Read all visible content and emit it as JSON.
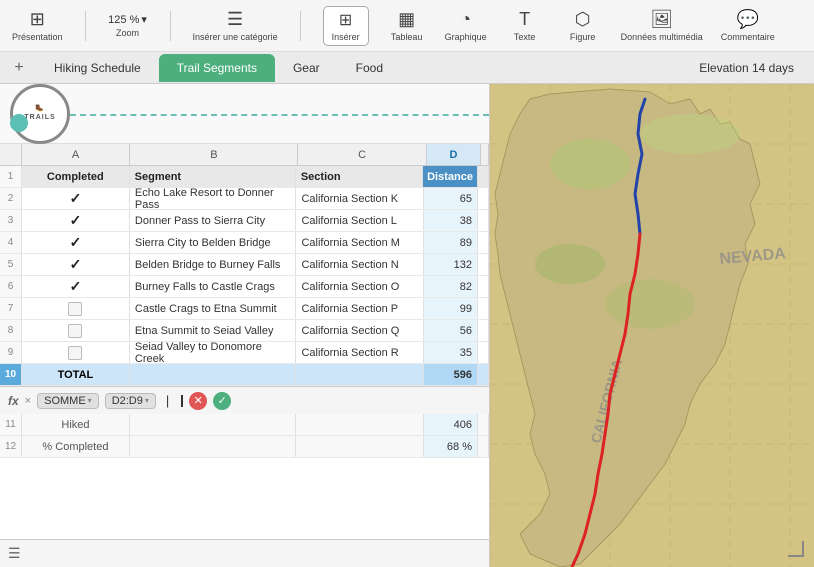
{
  "toolbar": {
    "presentation_label": "Présentation",
    "zoom_label": "Zoom",
    "zoom_value": "125 %",
    "insert_category_label": "Insérer une catégorie",
    "insert_label": "Insérer",
    "table_label": "Tableau",
    "chart_label": "Graphique",
    "text_label": "Texte",
    "shape_label": "Figure",
    "media_label": "Données multimédia",
    "comment_label": "Commentaire"
  },
  "tabs": {
    "add_icon": "+",
    "items": [
      {
        "id": "hiking",
        "label": "Hiking Schedule",
        "active": false
      },
      {
        "id": "trail",
        "label": "Trail Segments",
        "active": true
      },
      {
        "id": "gear",
        "label": "Gear",
        "active": false
      },
      {
        "id": "food",
        "label": "Food",
        "active": false
      }
    ],
    "elevation_label": "Elevation 14 days"
  },
  "logo": {
    "text": "TRAILS"
  },
  "col_headers": {
    "row_num": "",
    "col_a": "A",
    "col_b": "B",
    "col_c": "C",
    "col_d": "D"
  },
  "table": {
    "headers": {
      "completed": "Completed",
      "segment": "Segment",
      "section": "Section",
      "distance": "Distance"
    },
    "rows": [
      {
        "num": 2,
        "completed": true,
        "segment": "Echo Lake Resort to Donner Pass",
        "section": "California Section K",
        "distance": "65"
      },
      {
        "num": 3,
        "completed": true,
        "segment": "Donner Pass to Sierra City",
        "section": "California Section L",
        "distance": "38"
      },
      {
        "num": 4,
        "completed": true,
        "segment": "Sierra City to Belden Bridge",
        "section": "California Section M",
        "distance": "89"
      },
      {
        "num": 5,
        "completed": true,
        "segment": "Belden Bridge to Burney Falls",
        "section": "California Section N",
        "distance": "132"
      },
      {
        "num": 6,
        "completed": true,
        "segment": "Burney Falls to Castle Crags",
        "section": "California Section O",
        "distance": "82"
      },
      {
        "num": 7,
        "completed": false,
        "segment": "Castle Crags to Etna Summit",
        "section": "California Section P",
        "distance": "99"
      },
      {
        "num": 8,
        "completed": false,
        "segment": "Etna Summit to Seiad Valley",
        "section": "California Section Q",
        "distance": "56"
      },
      {
        "num": 9,
        "completed": false,
        "segment": "Seiad Valley to Donomore Creek",
        "section": "California Section R",
        "distance": "35"
      }
    ],
    "total_row": {
      "num": 10,
      "label": "TOTAL",
      "value": "596"
    },
    "hiked_row": {
      "num": 11,
      "label": "Hiked",
      "value": "406"
    },
    "pct_row": {
      "num": 12,
      "label": "% Completed",
      "value": "68 %"
    }
  },
  "formula_bar": {
    "fx_label": "fx",
    "function_name": "SOMME",
    "range": "D2:D9",
    "cursor_char": "|"
  }
}
